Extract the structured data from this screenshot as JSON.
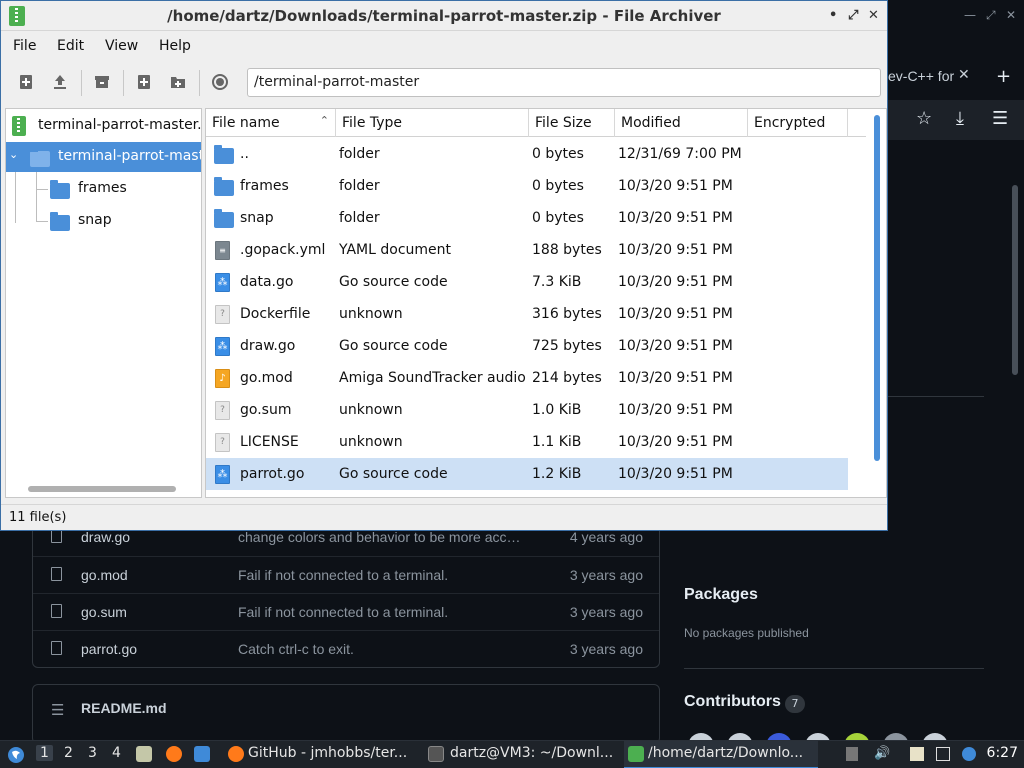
{
  "archiver": {
    "title": "/home/dartz/Downloads/terminal-parrot-master.zip - File Archiver",
    "window_buttons": {
      "minimize": "•",
      "maximize": "⤢",
      "close": "✕"
    },
    "menus": [
      "File",
      "Edit",
      "View",
      "Help"
    ],
    "location": "/terminal-parrot-master",
    "tree": {
      "root": "terminal-parrot-master.zip",
      "folder": "terminal-parrot-master",
      "children": [
        "frames",
        "snap"
      ]
    },
    "columns": [
      "File name",
      "File Type",
      "File Size",
      "Modified",
      "Encrypted"
    ],
    "sort_arrow": "⌃",
    "rows": [
      {
        "icon": "folder",
        "name": "..",
        "type": "folder",
        "size": "0 bytes",
        "modified": "12/31/69 7:00 PM"
      },
      {
        "icon": "folder",
        "name": "frames",
        "type": "folder",
        "size": "0 bytes",
        "modified": "10/3/20 9:51 PM"
      },
      {
        "icon": "folder",
        "name": "snap",
        "type": "folder",
        "size": "0 bytes",
        "modified": "10/3/20 9:51 PM"
      },
      {
        "icon": "yaml",
        "name": ".gopack.yml",
        "type": "YAML document",
        "size": "188 bytes",
        "modified": "10/3/20 9:51 PM"
      },
      {
        "icon": "go",
        "name": "data.go",
        "type": "Go source code",
        "size": "7.3 KiB",
        "modified": "10/3/20 9:51 PM"
      },
      {
        "icon": "unknown",
        "name": "Dockerfile",
        "type": "unknown",
        "size": "316 bytes",
        "modified": "10/3/20 9:51 PM"
      },
      {
        "icon": "go",
        "name": "draw.go",
        "type": "Go source code",
        "size": "725 bytes",
        "modified": "10/3/20 9:51 PM"
      },
      {
        "icon": "audio",
        "name": "go.mod",
        "type": "Amiga SoundTracker audio",
        "size": "214 bytes",
        "modified": "10/3/20 9:51 PM"
      },
      {
        "icon": "unknown",
        "name": "go.sum",
        "type": "unknown",
        "size": "1.0 KiB",
        "modified": "10/3/20 9:51 PM"
      },
      {
        "icon": "unknown",
        "name": "LICENSE",
        "type": "unknown",
        "size": "1.1 KiB",
        "modified": "10/3/20 9:51 PM"
      },
      {
        "icon": "go",
        "name": "parrot.go",
        "type": "Go source code",
        "size": "1.2 KiB",
        "modified": "10/3/20 9:51 PM",
        "selected": true
      }
    ],
    "status": "11 file(s)"
  },
  "browser_bg": {
    "tab_title": "ev-C++ for",
    "tab_close": "✕",
    "new_tab": "+",
    "files": [
      {
        "name": "draw.go",
        "message": "change colors and behavior to be more acc…",
        "age": "4 years ago"
      },
      {
        "name": "go.mod",
        "message": "Fail if not connected to a terminal.",
        "age": "3 years ago"
      },
      {
        "name": "go.sum",
        "message": "Fail if not connected to a terminal.",
        "age": "3 years ago"
      },
      {
        "name": "parrot.go",
        "message": "Catch ctrl-c to exit.",
        "age": "3 years ago"
      }
    ],
    "readme": "README.md",
    "packages_title": "Packages",
    "packages_sub": "No packages published",
    "contributors_title": "Contributors",
    "contributors_count": "7"
  },
  "taskbar": {
    "workspaces": [
      "1",
      "2",
      "3",
      "4"
    ],
    "tasks": [
      {
        "label": "GitHub - jmhobbs/ter...",
        "icon": "firefox-icon"
      },
      {
        "label": "dartz@VM3: ~/Downl...",
        "icon": "terminal-icon"
      },
      {
        "label": "/home/dartz/Downlo...",
        "icon": "archive-icon",
        "active": true
      }
    ],
    "clock": "6:27"
  },
  "colors": {
    "accent": "#4a8fd9",
    "selection": "#cde0f5",
    "zip_green": "#4caf50"
  }
}
